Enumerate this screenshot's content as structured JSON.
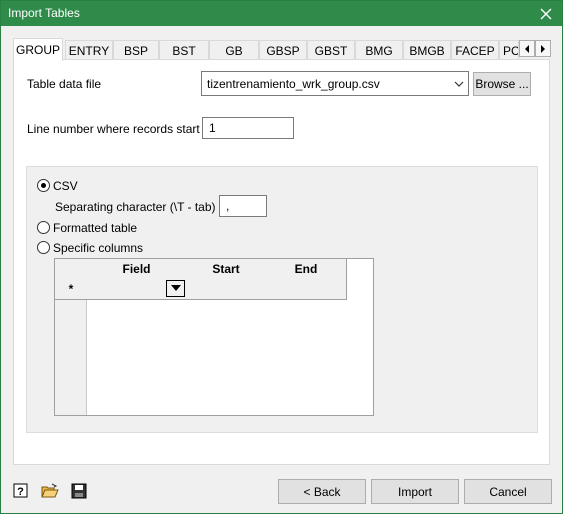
{
  "window": {
    "title": "Import Tables"
  },
  "tabs": [
    {
      "label": "GROUP"
    },
    {
      "label": "ENTRY"
    },
    {
      "label": "BSP"
    },
    {
      "label": "BST"
    },
    {
      "label": "GB"
    },
    {
      "label": "GBSP"
    },
    {
      "label": "GBST"
    },
    {
      "label": "BMG"
    },
    {
      "label": "BMGB"
    },
    {
      "label": "FACEP"
    },
    {
      "label": "PC"
    }
  ],
  "form": {
    "table_data_file_label": "Table data file",
    "table_data_file_value": "tizentrenamiento_wrk_group.csv",
    "browse_label": "Browse ...",
    "line_number_label": "Line number where records start",
    "line_number_value": "1"
  },
  "format": {
    "csv_label": "CSV",
    "csv_selected": true,
    "separator_label": "Separating character (\\T - tab)",
    "separator_value": ",",
    "formatted_label": "Formatted table",
    "specific_label": "Specific columns"
  },
  "grid": {
    "columns": [
      "Field",
      "Start",
      "End"
    ],
    "new_row_marker": "*"
  },
  "footer": {
    "back_label": "< Back",
    "import_label": "Import",
    "cancel_label": "Cancel"
  }
}
